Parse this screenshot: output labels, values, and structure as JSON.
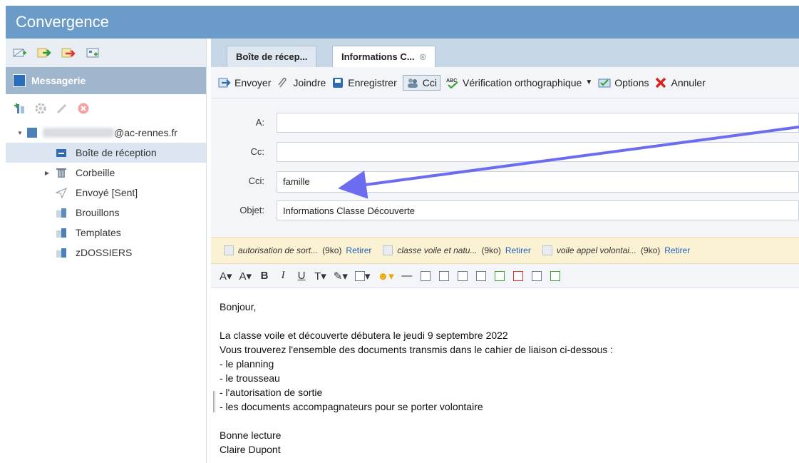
{
  "app": {
    "title": "Convergence"
  },
  "left": {
    "section_title": "Messagerie",
    "account_email_suffix": "@ac-rennes.fr",
    "folders": [
      {
        "label": "Boîte de réception",
        "selected": true,
        "expandable": false
      },
      {
        "label": "Corbeille",
        "selected": false,
        "expandable": true
      },
      {
        "label": "Envoyé [Sent]",
        "selected": false,
        "expandable": false
      },
      {
        "label": "Brouillons",
        "selected": false,
        "expandable": false
      },
      {
        "label": "Templates",
        "selected": false,
        "expandable": false
      },
      {
        "label": "zDOSSIERS",
        "selected": false,
        "expandable": false
      }
    ]
  },
  "tabs": [
    {
      "label": "Boîte de récep..."
    },
    {
      "label": "Informations C...",
      "active": true
    }
  ],
  "toolbar": {
    "send": "Envoyer",
    "attach": "Joindre",
    "save": "Enregistrer",
    "bcc": "Cci",
    "spellcheck": "Vérification orthographique",
    "options": "Options",
    "cancel": "Annuler"
  },
  "fields": {
    "to_label": "A:",
    "to_value": "",
    "cc_label": "Cc:",
    "cc_value": "",
    "bcc_label": "Cci:",
    "bcc_value": "famille",
    "subject_label": "Objet:",
    "subject_value": "Informations Classe Découverte"
  },
  "attachments": [
    {
      "name": "autorisation de sort...",
      "size": "(9ko)",
      "remove": "Retirer"
    },
    {
      "name": "classe voile et natu...",
      "size": "(9ko)",
      "remove": "Retirer"
    },
    {
      "name": "voile appel volontai...",
      "size": "(9ko)",
      "remove": "Retirer"
    }
  ],
  "body_lines": [
    "Bonjour,",
    "",
    "La classe voile et découverte débutera le jeudi 9 septembre 2022",
    "Vous trouverez l'ensemble des documents transmis dans le cahier de liaison ci-dessous :",
    "- le planning",
    "- le trousseau",
    "- l'autorisation de sortie",
    "- les documents accompagnateurs pour se porter volontaire",
    "",
    "Bonne lecture",
    "Claire Dupont"
  ],
  "colors": {
    "header": "#6b9bc9",
    "section": "#9fb6cc",
    "attachment_bar": "#fbf2d3",
    "link": "#1f62b5",
    "annotation_arrow": "#6c6cf0"
  }
}
